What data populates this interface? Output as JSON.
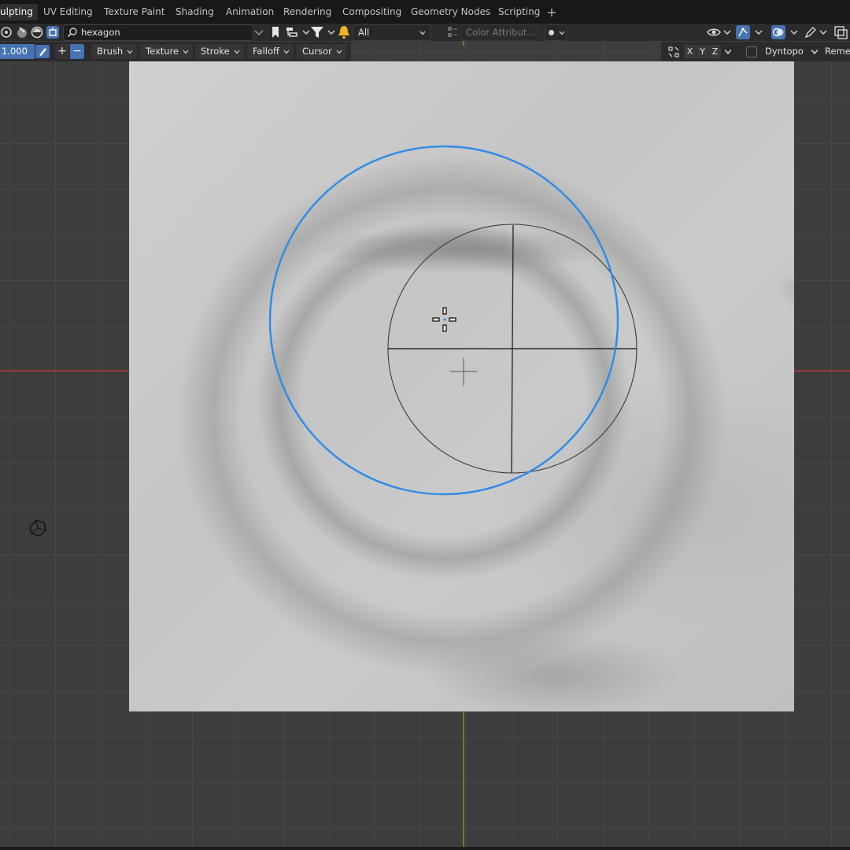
{
  "workspace_tabs": [
    {
      "label": "ulpting",
      "active": true
    },
    {
      "label": "UV Editing",
      "active": false
    },
    {
      "label": "Texture Paint",
      "active": false
    },
    {
      "label": "Shading",
      "active": false
    },
    {
      "label": "Animation",
      "active": false
    },
    {
      "label": "Rendering",
      "active": false
    },
    {
      "label": "Compositing",
      "active": false
    },
    {
      "label": "Geometry Nodes",
      "active": false
    },
    {
      "label": "Scripting",
      "active": false
    }
  ],
  "add_workspace_symbol": "+",
  "header": {
    "search_value": "hexagon",
    "filter_value": "All",
    "color_attribute_label": "Color Attribut...",
    "icons": [
      "mode-icon",
      "brush-icon",
      "material-icon",
      "bookmark-icon",
      "hierarchy-icon",
      "filter-icon",
      "alert-icon",
      "visibility-icon",
      "gizmo-icon",
      "overlay-icon",
      "edit-icon",
      "xray-icon"
    ]
  },
  "tool_settings": {
    "strength_value": "1.000",
    "add_symbol": "+",
    "subtract_symbol": "−",
    "brush_label": "Brush",
    "texture_label": "Texture",
    "stroke_label": "Stroke",
    "falloff_label": "Falloff",
    "cursor_label": "Cursor",
    "axis_x": "X",
    "axis_y": "Y",
    "axis_z": "Z",
    "dyntopo_label": "Dyntopo",
    "remesh_label": "Reme"
  },
  "colors": {
    "brush_circle": "#2e8be8",
    "x_axis": "#c03a3a",
    "y_axis": "#7fa63a",
    "active_field": "#4772b3"
  }
}
